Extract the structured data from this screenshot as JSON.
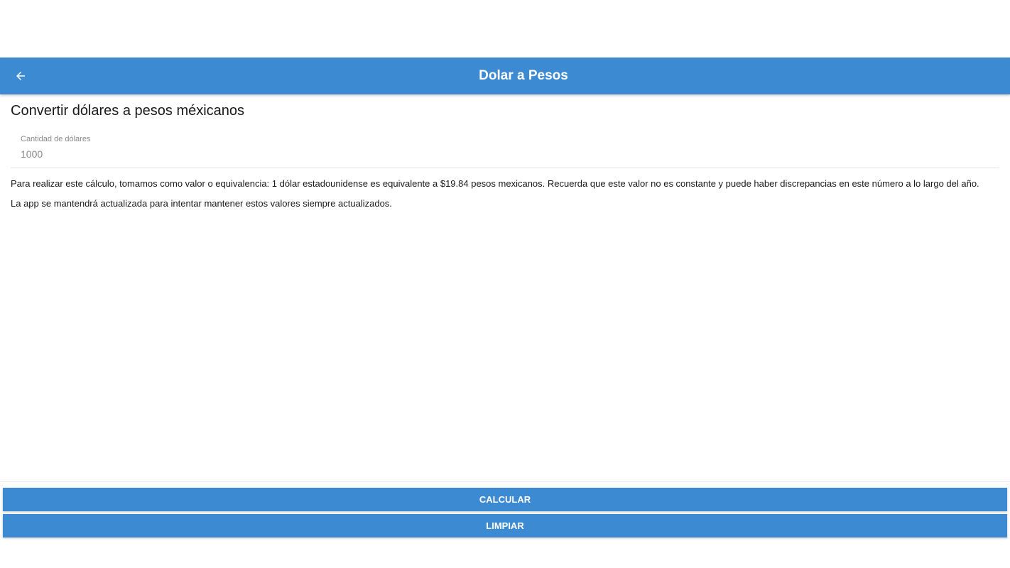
{
  "app_bar": {
    "title": "Dolar a Pesos",
    "back_icon": "arrow-left-icon",
    "color": "#3c8ad1"
  },
  "main": {
    "heading": "Convertir dólares a pesos méxicanos",
    "amount_field": {
      "label": "Cantidad de dólares",
      "placeholder": "1000",
      "value": ""
    },
    "paragraphs": [
      "Para realizar este cálculo, tomamos como valor o equivalencia: 1 dólar estadounidense es equivalente a $19.84 pesos mexicanos. Recuerda que este valor no es constante y puede haber discrepancias en este número a lo largo del año.",
      "La app se mantendrá actualizada para intentar mantener estos valores siempre actualizados."
    ]
  },
  "actions": {
    "calculate_label": "CALCULAR",
    "clear_label": "LIMPIAR"
  }
}
